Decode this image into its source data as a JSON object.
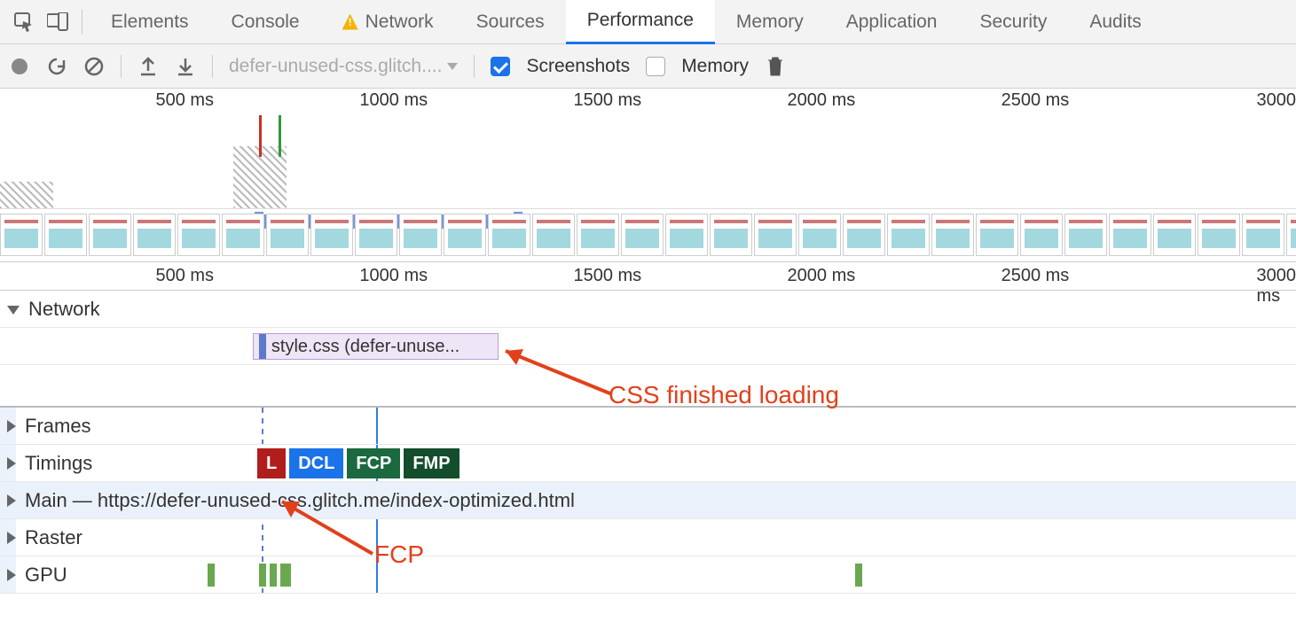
{
  "tabs": {
    "items": [
      "Elements",
      "Console",
      "Network",
      "Sources",
      "Performance",
      "Memory",
      "Application",
      "Security",
      "Audits"
    ],
    "active": "Performance",
    "warning_on": "Network"
  },
  "toolbar": {
    "dropdown": "defer-unused-css.glitch....",
    "screenshots_label": "Screenshots",
    "screenshots_checked": true,
    "memory_label": "Memory",
    "memory_checked": false
  },
  "overview": {
    "ticks": [
      "500 ms",
      "1000 ms",
      "1500 ms",
      "2000 ms",
      "2500 ms",
      "3000"
    ],
    "tick_positions_pct": [
      16.5,
      33,
      49.5,
      66,
      82.5,
      100
    ],
    "marker_red_pct": 20,
    "marker_green_pct": 21.5,
    "selection_start_pct": 20,
    "selection_end_pct": 40,
    "thumbnails": 30
  },
  "timeline": {
    "ticks": [
      "500 ms",
      "1000 ms",
      "1500 ms",
      "2000 ms",
      "2500 ms",
      "3000 ms"
    ],
    "tick_positions_pct": [
      16.5,
      33,
      49.5,
      66,
      82.5,
      100
    ],
    "tracks": {
      "network": "Network",
      "network_item": "style.css (defer-unuse...",
      "network_item_left_pct": 19.5,
      "network_item_width_pct": 19,
      "frames": "Frames",
      "timings": "Timings",
      "timing_badges": [
        "L",
        "DCL",
        "FCP",
        "FMP"
      ],
      "main": "Main — https://defer-unused-css.glitch.me/index-optimized.html",
      "raster": "Raster",
      "gpu": "GPU"
    },
    "vline_dash_pct": 20.2,
    "vline_solid_pct": 29,
    "highlight_left_pct": 0,
    "highlight_right_pct": 1.2
  },
  "annotations": {
    "css_label": "CSS finished loading",
    "fcp_label": "FCP"
  }
}
